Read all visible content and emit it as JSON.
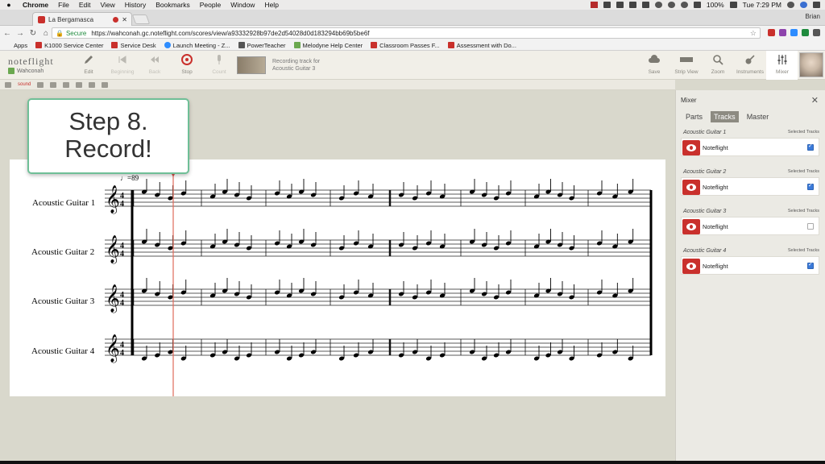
{
  "menubar": {
    "app": "Chrome",
    "items": [
      "File",
      "Edit",
      "View",
      "History",
      "Bookmarks",
      "People",
      "Window",
      "Help"
    ],
    "clock": "Tue 7:29 PM",
    "battery": "100%"
  },
  "browser": {
    "tab_title": "La Bergamasca",
    "profile": "Brian",
    "secure_label": "Secure",
    "url": "https://wahconah.gc.noteflight.com/scores/view/a93332928b97de2d54028d0d183294bb69b5be6f"
  },
  "bookmarks": [
    {
      "label": "Apps",
      "color": "#777777"
    },
    {
      "label": "K1000 Service Center",
      "color": "#c9302c"
    },
    {
      "label": "Service Desk",
      "color": "#c9302c"
    },
    {
      "label": "Launch Meeting - Z...",
      "color": "#2d8cff"
    },
    {
      "label": "PowerTeacher",
      "color": "#555555"
    },
    {
      "label": "Melodyne Help Center",
      "color": "#6aa84f"
    },
    {
      "label": "Classroom Passes F...",
      "color": "#c9302c"
    },
    {
      "label": "Assessment with Do...",
      "color": "#c9302c"
    }
  ],
  "noteflight": {
    "logo": "noteflight",
    "workspace": "Wahconah",
    "tools_left": [
      "Edit",
      "Beginning",
      "Back",
      "Stop",
      "Count"
    ],
    "record_label": "Stop",
    "status_line1": "Recording track for",
    "status_line2": "Acoustic Guitar 3",
    "tools_right": [
      "Save",
      "Strip View",
      "Zoom",
      "Instruments",
      "Mixer"
    ],
    "substrip_label": "sound"
  },
  "callout": {
    "line1": "Step 8.",
    "line2": "Record!"
  },
  "score": {
    "tempo": "♩=89",
    "instruments": [
      "Acoustic Guitar 1",
      "Acoustic Guitar 2",
      "Acoustic Guitar 3",
      "Acoustic Guitar 4"
    ]
  },
  "mixer": {
    "title": "Mixer",
    "tabs": [
      "Parts",
      "Tracks",
      "Master"
    ],
    "active_tab": "Tracks",
    "selected_label": "Selected Tracks",
    "tracks": [
      {
        "name": "Acoustic Guitar 1",
        "source": "Noteflight",
        "selected": true
      },
      {
        "name": "Acoustic Guitar 2",
        "source": "Noteflight",
        "selected": true
      },
      {
        "name": "Acoustic Guitar 3",
        "source": "Noteflight",
        "selected": false
      },
      {
        "name": "Acoustic Guitar 4",
        "source": "Noteflight",
        "selected": true
      }
    ]
  }
}
